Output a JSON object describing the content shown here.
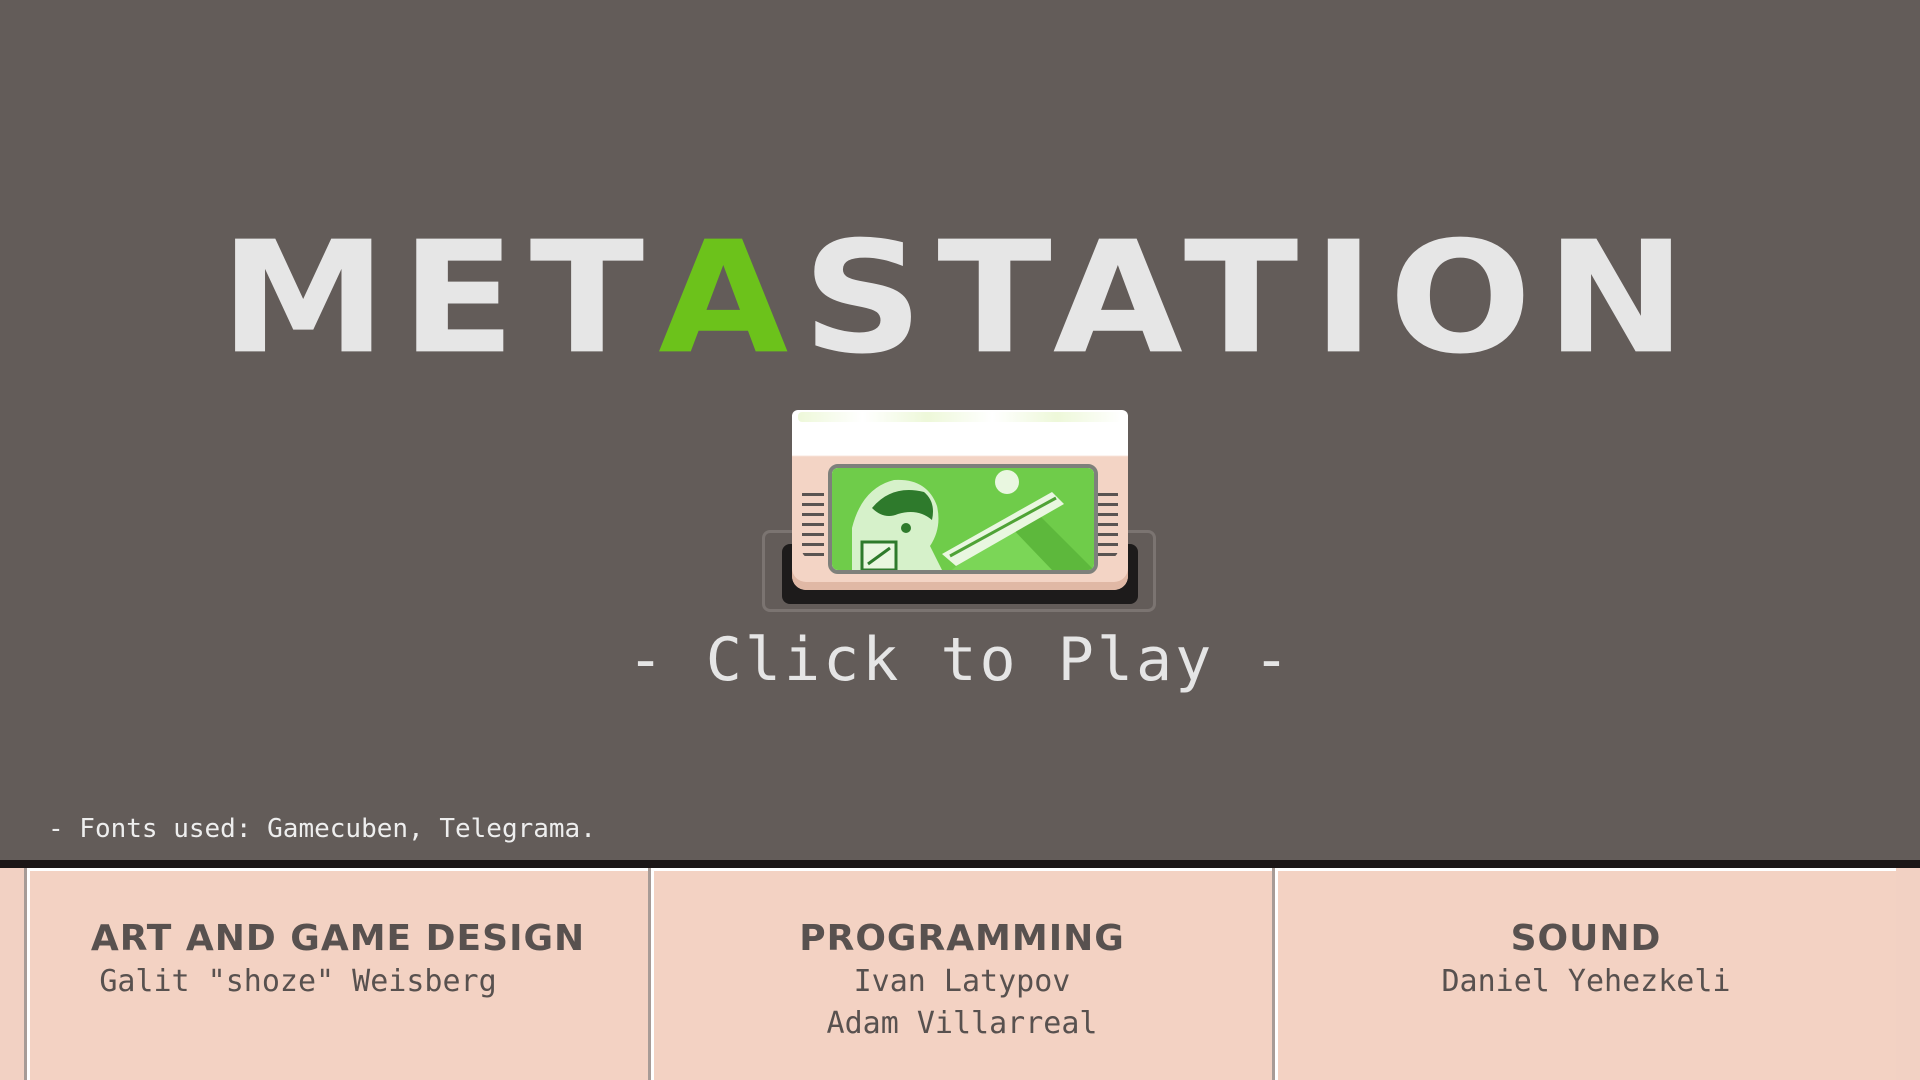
{
  "title": {
    "before": "MET",
    "accent": "A",
    "after": "STATION"
  },
  "colors": {
    "background": "#635c59",
    "accent": "#6cc21b",
    "title": "#e6e6e6",
    "panel": "#f3d2c3",
    "panel_text": "#58514f"
  },
  "cartridge": {
    "icon": "game-cartridge-icon"
  },
  "cta": "- Click to Play -",
  "fonts_note": "- Fonts used: Gamecuben, Telegrama.",
  "credits": [
    {
      "heading": "ART AND GAME DESIGN",
      "names": [
        "Galit \"shoze\" Weisberg"
      ]
    },
    {
      "heading": "PROGRAMMING",
      "names": [
        "Ivan Latypov",
        "Adam Villarreal"
      ]
    },
    {
      "heading": "SOUND",
      "names": [
        "Daniel Yehezkeli"
      ]
    }
  ]
}
